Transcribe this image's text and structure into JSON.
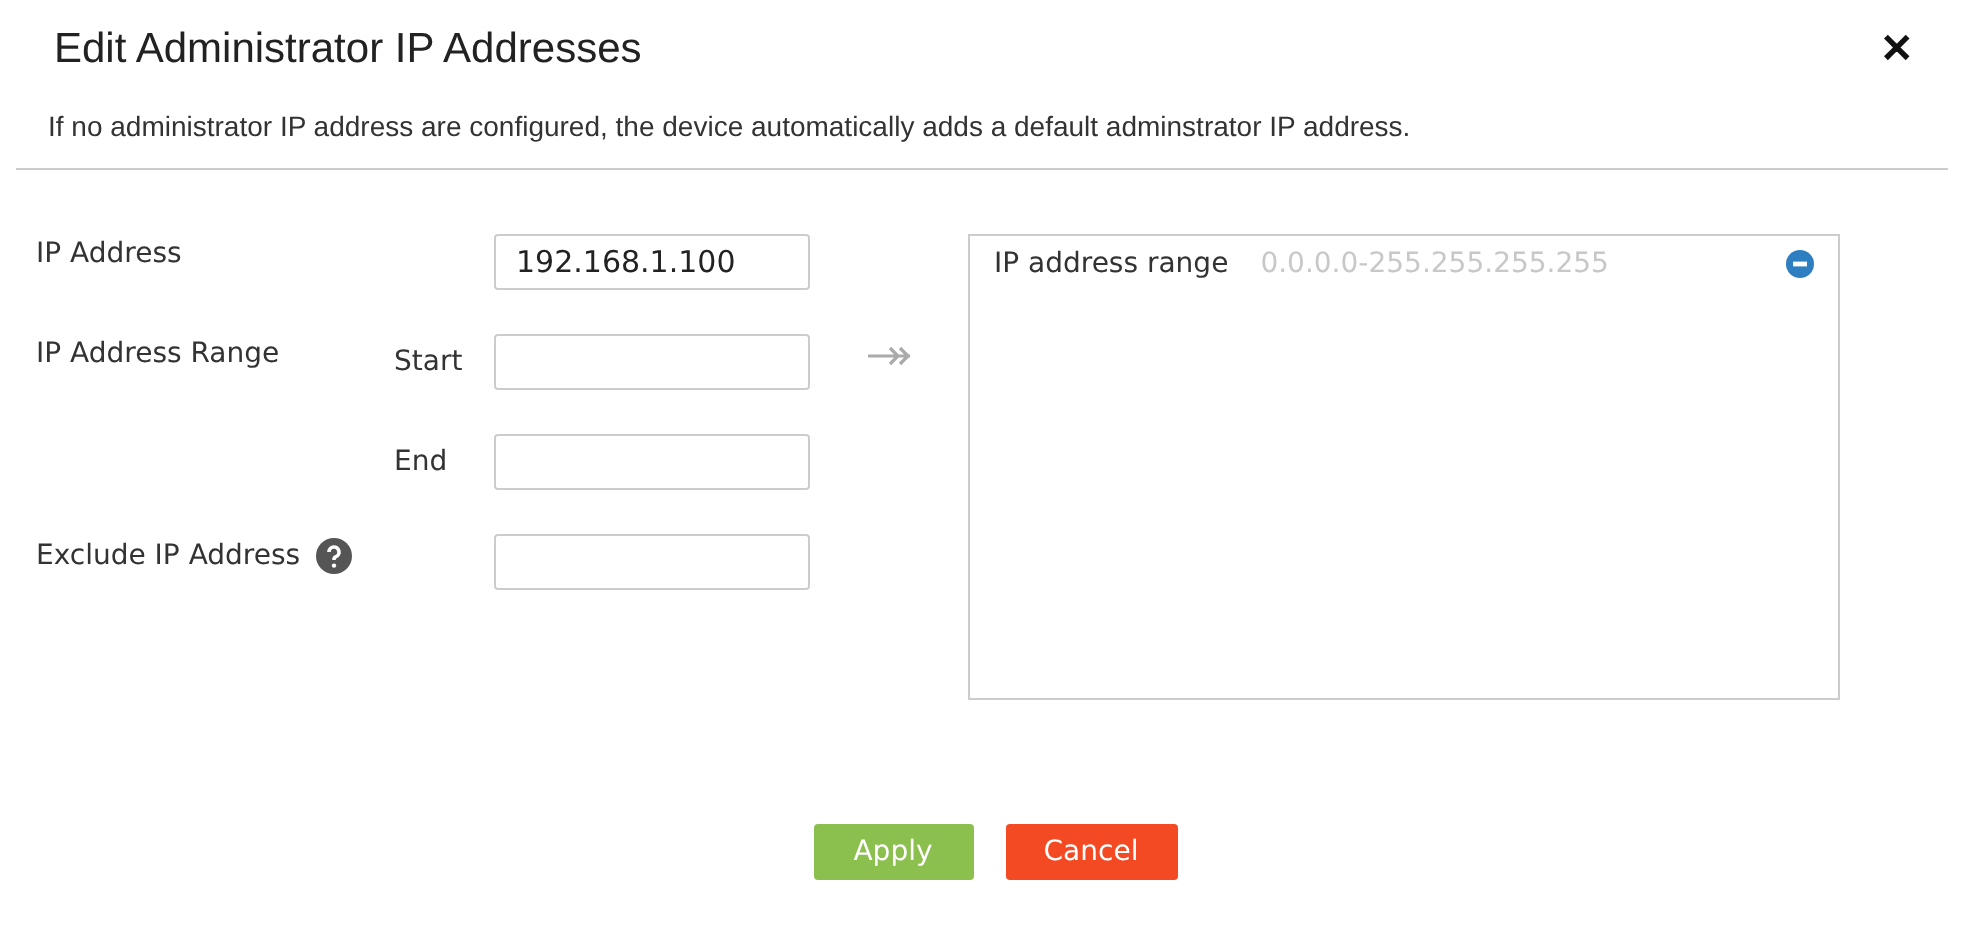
{
  "dialog": {
    "title": "Edit Administrator IP Addresses",
    "close": "✕",
    "notice": "If no administrator IP address are configured, the device automatically adds a default adminstrator IP address."
  },
  "form": [
    {
      "label": "IP Address",
      "value": "192.168.1.100"
    },
    {
      "label": "IP Address Range",
      "sublabel": "Start"
    },
    {
      "sublabel": "End"
    },
    {
      "label": "Exclude IP Address",
      "help": true
    }
  ],
  "list": [
    {
      "label": "IP address range",
      "value": "0.0.0.0-255.255.255.255"
    }
  ],
  "buttons": [
    {
      "label": "Apply",
      "kind": "primary"
    },
    {
      "label": "Cancel",
      "kind": "danger"
    }
  ]
}
